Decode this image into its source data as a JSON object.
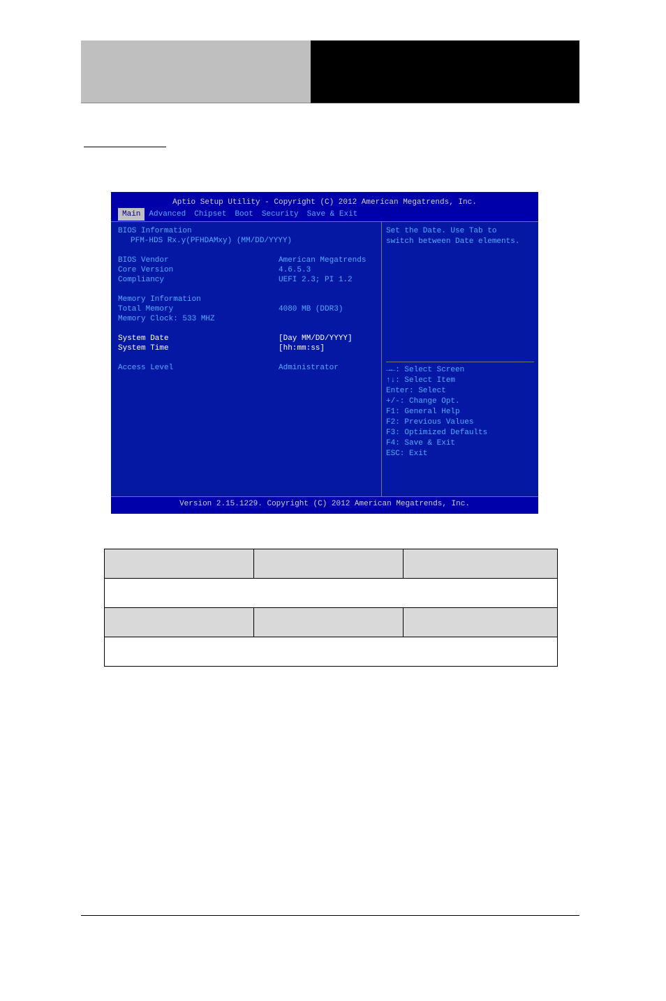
{
  "bios": {
    "title": "Aptio Setup Utility - Copyright (C) 2012 American Megatrends, Inc.",
    "menu": {
      "items": [
        "Main",
        "Advanced",
        "Chipset",
        "Boot",
        "Security",
        "Save & Exit"
      ],
      "active": 0
    },
    "left": {
      "heading1": "BIOS Information",
      "model": "PFM-HDS Rx.y(PFHDAMxy) (MM/DD/YYYY)",
      "vendor_label": "BIOS Vendor",
      "vendor_value": "American Megatrends",
      "core_label": "Core Version",
      "core_value": "4.6.5.3",
      "comp_label": "Compliancy",
      "comp_value": "UEFI 2.3; PI 1.2",
      "heading2": "Memory Information",
      "mem_label": "Total Memory",
      "mem_value": "4080 MB (DDR3)",
      "mem_clock": "Memory Clock: 533 MHZ",
      "date_label": "System Date",
      "date_value": "[Day MM/DD/YYYY]",
      "time_label": "System Time",
      "time_value": "[hh:mm:ss]",
      "access_label": "Access Level",
      "access_value": "Administrator"
    },
    "right": {
      "help1": "Set the Date. Use Tab to",
      "help2": "switch between Date elements.",
      "nav": [
        "→←: Select Screen",
        "↑↓: Select Item",
        "Enter: Select",
        "+/-: Change Opt.",
        "F1: General Help",
        "F2: Previous Values",
        "F3: Optimized Defaults",
        "F4: Save & Exit",
        "ESC: Exit"
      ]
    },
    "footer": "Version 2.15.1229. Copyright (C) 2012 American Megatrends, Inc."
  },
  "table": {
    "r1c1": "",
    "r1c2": "",
    "r1c3": "",
    "r2": "",
    "r3c1": "",
    "r3c2": "",
    "r3c3": "",
    "r4": ""
  }
}
